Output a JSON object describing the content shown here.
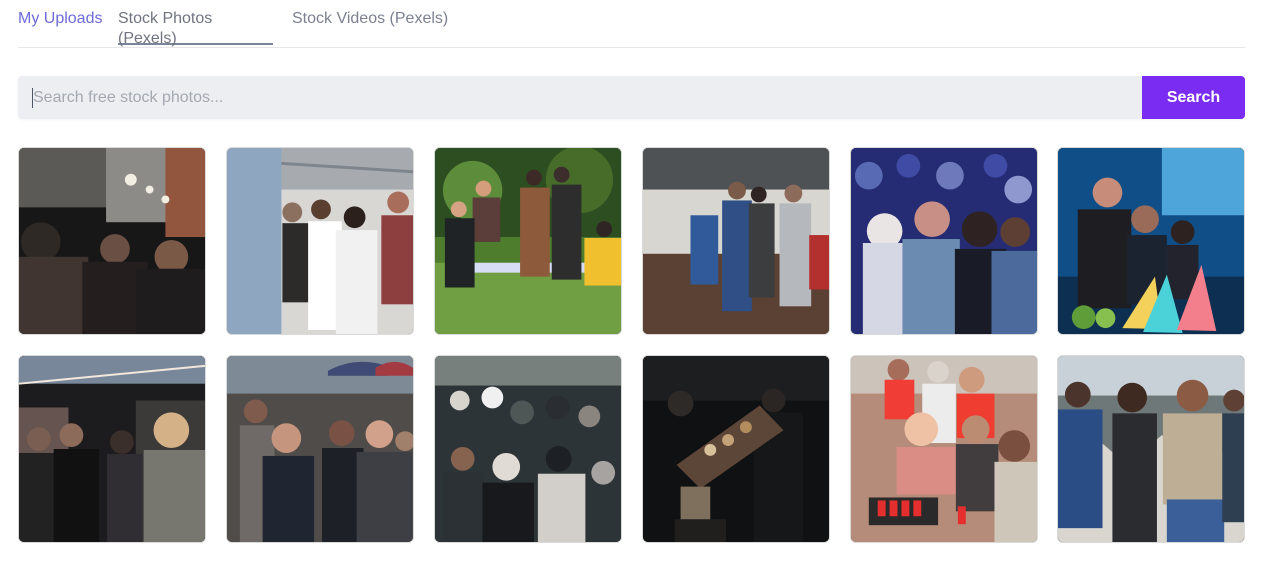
{
  "tabs": {
    "my_uploads": "My Uploads",
    "stock_photos": "Stock Photos (Pexels)",
    "stock_videos": "Stock Videos (Pexels)"
  },
  "search": {
    "placeholder": "Search free stock photos...",
    "button_label": "Search"
  },
  "colors": {
    "accent": "#7b2cf2",
    "active_tab": "#6d6bd9"
  },
  "photos": [
    {
      "name": "party-photo-1"
    },
    {
      "name": "party-photo-2"
    },
    {
      "name": "party-photo-3"
    },
    {
      "name": "party-photo-4"
    },
    {
      "name": "party-photo-5"
    },
    {
      "name": "party-photo-6"
    },
    {
      "name": "party-photo-7"
    },
    {
      "name": "party-photo-8"
    },
    {
      "name": "party-photo-9"
    },
    {
      "name": "party-photo-10"
    },
    {
      "name": "party-photo-11"
    },
    {
      "name": "party-photo-12"
    }
  ]
}
